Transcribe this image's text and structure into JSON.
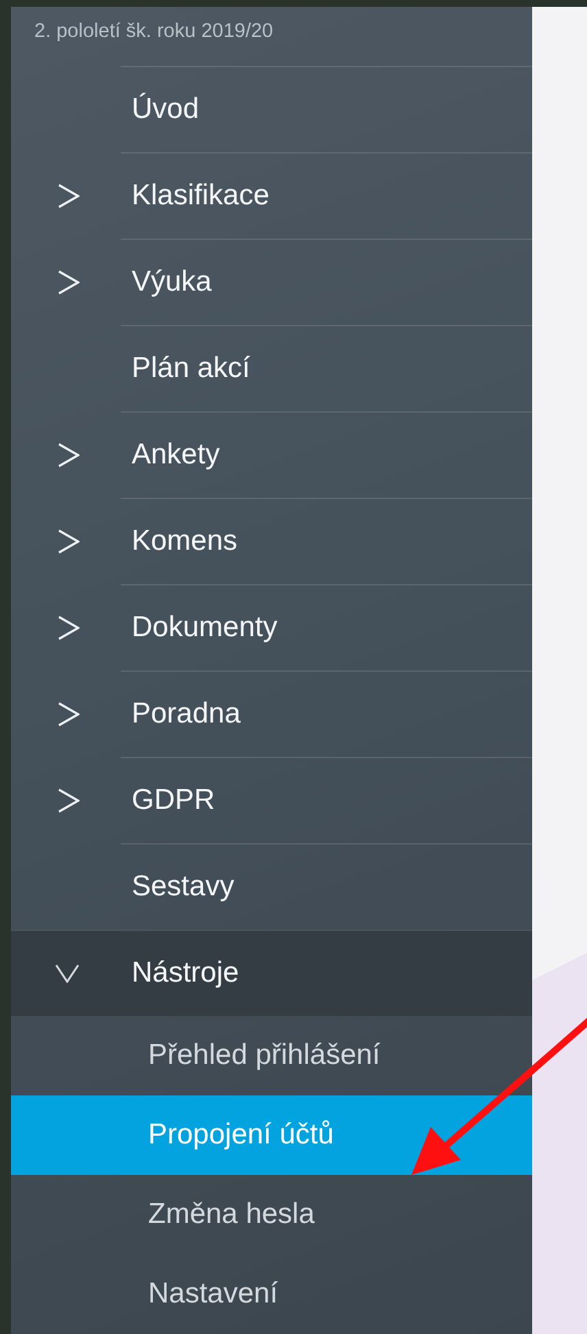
{
  "sidebar": {
    "term": "2. pololetí šk. roku 2019/20",
    "items": [
      {
        "label": "Úvod",
        "kind": "link"
      },
      {
        "label": "Klasifikace",
        "kind": "group",
        "expanded": false
      },
      {
        "label": "Výuka",
        "kind": "group",
        "expanded": false
      },
      {
        "label": "Plán akcí",
        "kind": "link"
      },
      {
        "label": "Ankety",
        "kind": "group",
        "expanded": false
      },
      {
        "label": "Komens",
        "kind": "group",
        "expanded": false
      },
      {
        "label": "Dokumenty",
        "kind": "group",
        "expanded": false
      },
      {
        "label": "Poradna",
        "kind": "group",
        "expanded": false
      },
      {
        "label": "GDPR",
        "kind": "group",
        "expanded": false
      },
      {
        "label": "Sestavy",
        "kind": "link"
      },
      {
        "label": "Nástroje",
        "kind": "group",
        "expanded": true,
        "children": [
          {
            "label": "Přehled přihlášení",
            "selected": false
          },
          {
            "label": "Propojení účtů",
            "selected": true
          },
          {
            "label": "Změna hesla",
            "selected": false
          },
          {
            "label": "Nastavení",
            "selected": false
          }
        ]
      }
    ]
  }
}
